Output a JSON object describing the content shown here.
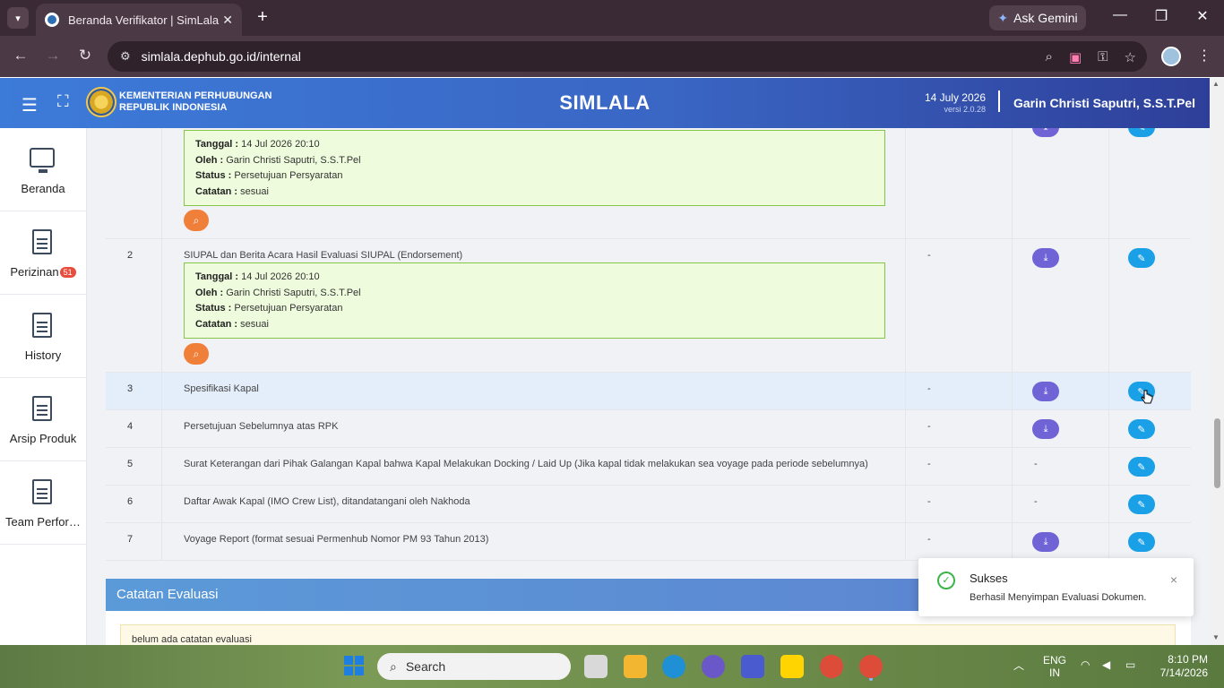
{
  "browser": {
    "tab_title": "Beranda Verifikator | SimLala",
    "url": "simlala.dephub.go.id/internal",
    "ask_gemini": "Ask Gemini"
  },
  "header": {
    "ministry_line1": "KEMENTERIAN PERHUBUNGAN",
    "ministry_line2": "REPUBLIK INDONESIA",
    "app_title": "SIMLALA",
    "date": "14 July 2026",
    "version": "versi 2.0.28",
    "user_name": "Garin Christi Saputri, S.S.T.Pel"
  },
  "sidebar": {
    "items": [
      {
        "label": "Beranda",
        "icon": "monitor-icon"
      },
      {
        "label": "Perizinan",
        "icon": "document-icon",
        "badge": "51"
      },
      {
        "label": "History",
        "icon": "document-icon"
      },
      {
        "label": "Arsip Produk",
        "icon": "document-icon"
      },
      {
        "label": "Team Performance",
        "icon": "document-icon"
      }
    ]
  },
  "documents": {
    "labels": {
      "tanggal": "Tanggal :",
      "oleh": "Oleh :",
      "status": "Status :",
      "catatan": "Catatan :"
    },
    "rows": [
      {
        "no": "",
        "name": "",
        "tanggal": "14 Jul 2026 20:10",
        "oleh": "Garin Christi Saputri, S.S.T.Pel",
        "status": "Persetujuan Persyaratan",
        "catatan": "sesuai"
      },
      {
        "no": "2",
        "name": "SIUPAL dan Berita Acara Hasil Evaluasi SIUPAL (Endorsement)",
        "col3": "-",
        "tanggal": "14 Jul 2026 20:10",
        "oleh": "Garin Christi Saputri, S.S.T.Pel",
        "status": "Persetujuan Persyaratan",
        "catatan": "sesuai"
      },
      {
        "no": "3",
        "name": "Spesifikasi Kapal",
        "col3": "-"
      },
      {
        "no": "4",
        "name": "Persetujuan Sebelumnya atas RPK",
        "col3": "-"
      },
      {
        "no": "5",
        "name": "Surat Keterangan dari Pihak Galangan Kapal bahwa Kapal Melakukan Docking / Laid Up (Jika kapal tidak melakukan sea voyage pada periode sebelumnya)",
        "col3": "-",
        "col4": "-"
      },
      {
        "no": "6",
        "name": "Daftar Awak Kapal (IMO Crew List), ditandatangani oleh Nakhoda",
        "col3": "-",
        "col4": "-"
      },
      {
        "no": "7",
        "name": "Voyage Report (format sesuai Permenhub Nomor PM 93 Tahun 2013)",
        "col3": "-"
      }
    ]
  },
  "evaluation": {
    "title": "Catatan Evaluasi",
    "empty_note": "belum ada catatan evaluasi"
  },
  "toast": {
    "title": "Sukses",
    "message": "Berhasil Menyimpan Evaluasi Dokumen.",
    "close": "×"
  },
  "taskbar": {
    "search_placeholder": "Search",
    "lang_line1": "ENG",
    "lang_line2": "IN",
    "time": "8:10 PM",
    "date": "7/14/2026"
  },
  "colors": {
    "header_start": "#3d7bd9",
    "header_end": "#2e3f99",
    "download_button": "#6f63d6",
    "edit_button": "#1aa0e6",
    "zoom_button": "#f07f3a",
    "info_box_border": "#86c44a",
    "success": "#3bb54a"
  }
}
